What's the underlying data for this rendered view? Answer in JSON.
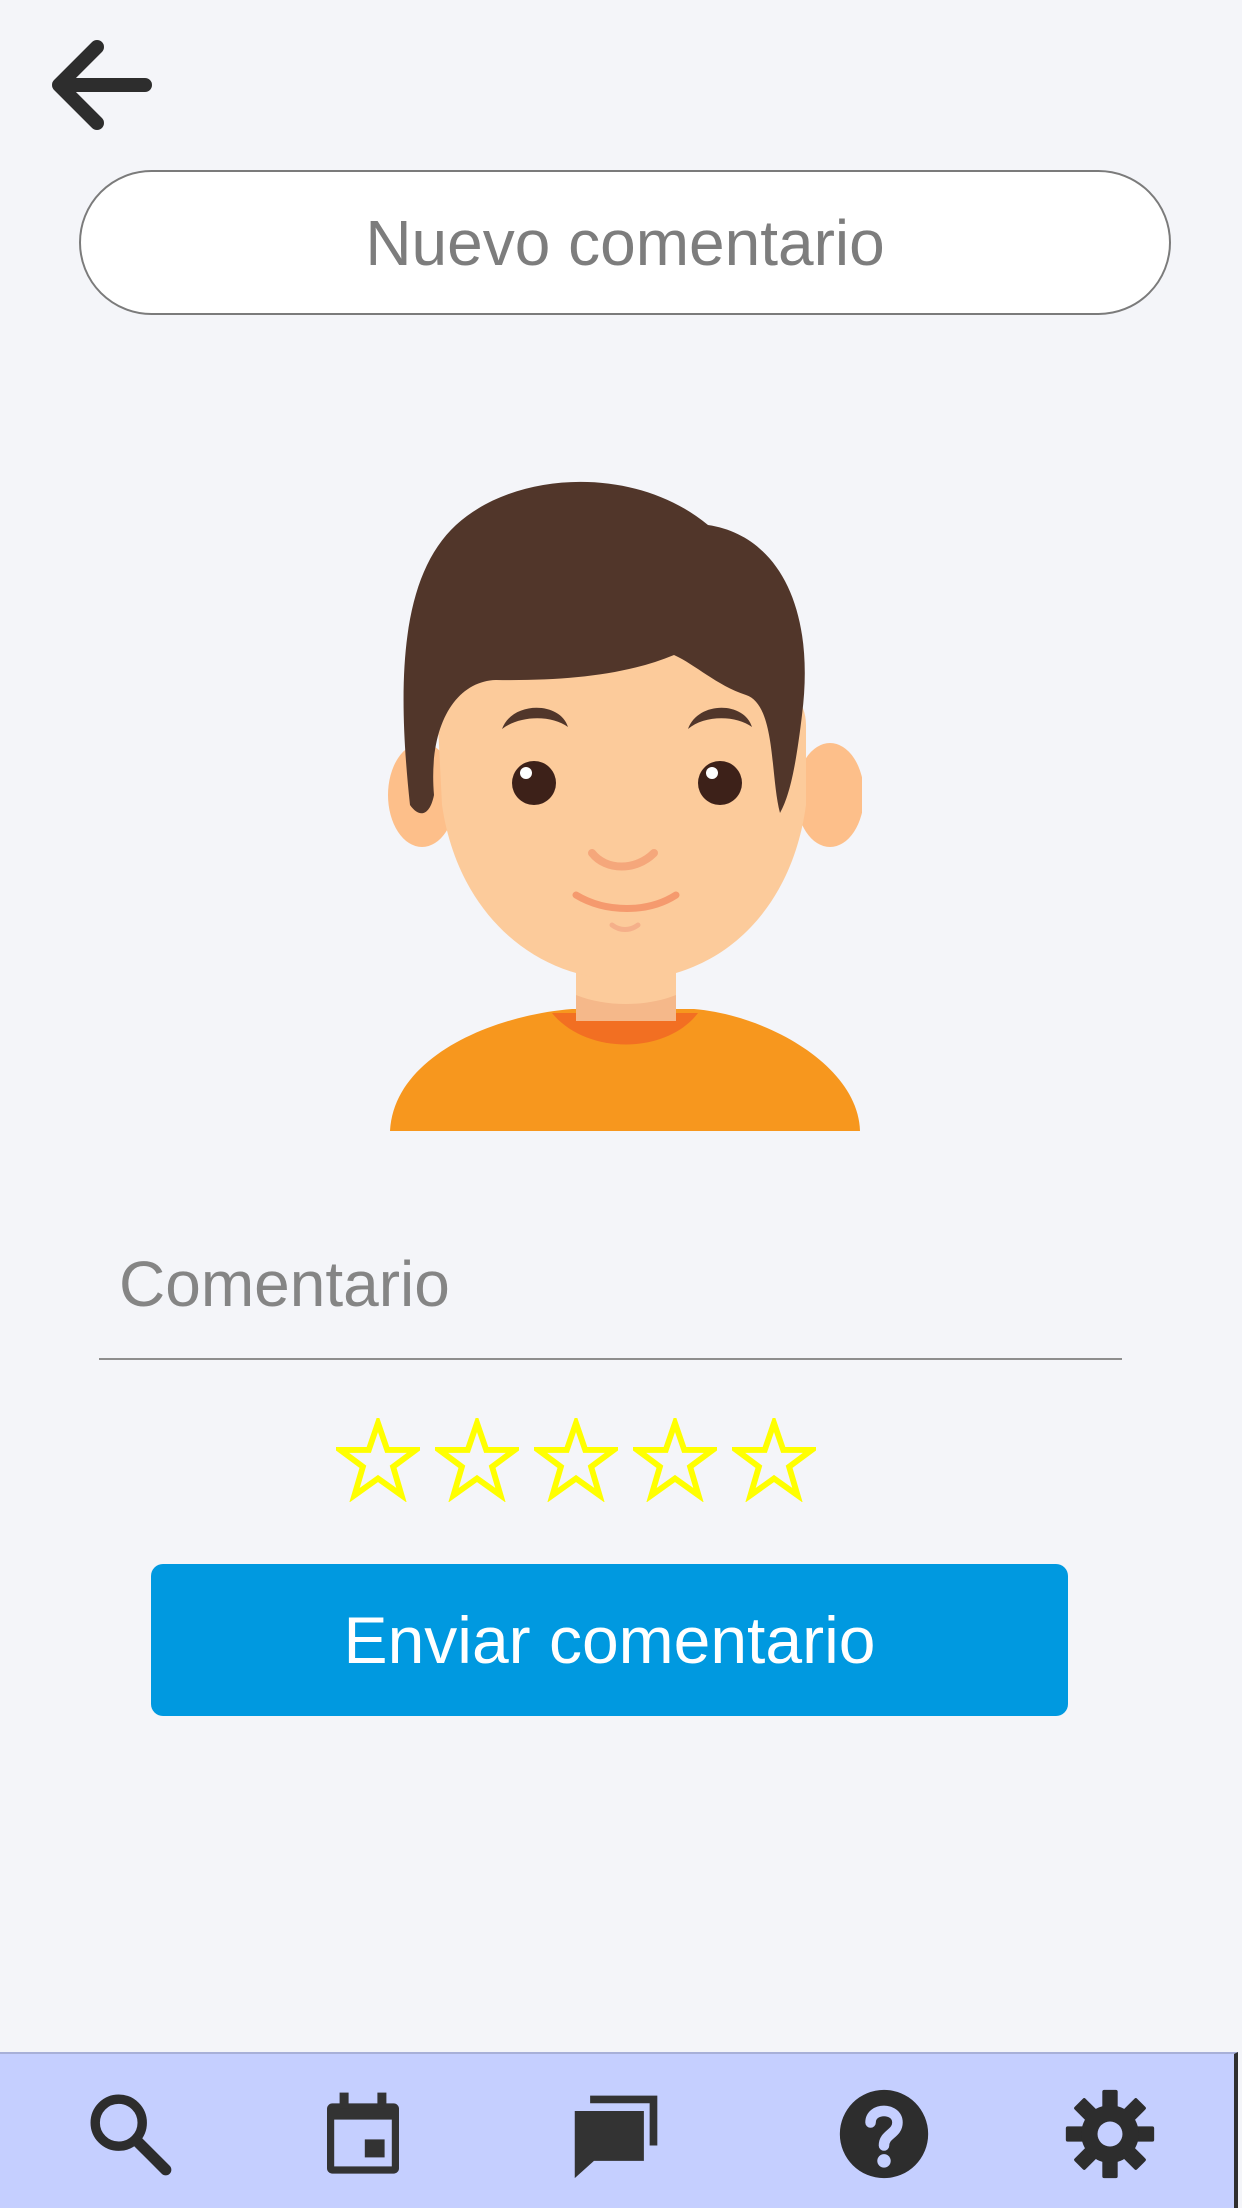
{
  "header": {
    "back_icon": "arrow-left-icon",
    "title": "Nuevo comentario"
  },
  "avatar": {
    "icon": "boy-avatar-illustration",
    "colors": {
      "hair": "#51362a",
      "skin": "#fccb9b",
      "shirt": "#f7971e",
      "collar": "#f26f22"
    }
  },
  "form": {
    "comment_placeholder": "Comentario",
    "comment_value": "",
    "rating": {
      "value": 0,
      "max": 5,
      "star_icon": "star-outline-icon",
      "star_color": "#ffff00"
    },
    "submit_label": "Enviar comentario"
  },
  "bottom_nav": {
    "items": [
      {
        "icon": "search-icon"
      },
      {
        "icon": "calendar-icon"
      },
      {
        "icon": "chat-icon"
      },
      {
        "icon": "help-icon"
      },
      {
        "icon": "gear-icon"
      }
    ],
    "background": "#c5cfff"
  },
  "colors": {
    "accent": "#0099e0",
    "page_background": "#f4f5f9"
  }
}
